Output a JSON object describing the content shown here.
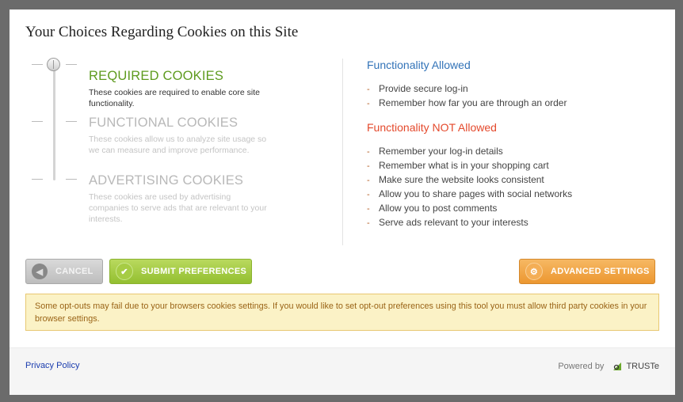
{
  "dialog": {
    "title": "Your Choices Regarding Cookies on this Site"
  },
  "levels": [
    {
      "name": "REQUIRED COOKIES",
      "description": "These cookies are required to enable core site functionality.",
      "state": "active"
    },
    {
      "name": "FUNCTIONAL COOKIES",
      "description": "These cookies allow us to analyze site usage so we can measure and improve performance.",
      "state": "inactive"
    },
    {
      "name": "ADVERTISING COOKIES",
      "description": "These cookies are used by advertising companies to serve ads that are relevant to your interests.",
      "state": "inactive"
    }
  ],
  "functionality": {
    "allowed_title": "Functionality Allowed",
    "allowed": [
      "Provide secure log-in",
      "Remember how far you are through an order"
    ],
    "not_allowed_title": "Functionality NOT Allowed",
    "not_allowed": [
      "Remember your log-in details",
      "Remember what is in your shopping cart",
      "Make sure the website looks consistent",
      "Allow you to share pages with social networks",
      "Allow you to post comments",
      "Serve ads relevant to your interests"
    ]
  },
  "buttons": {
    "cancel": "CANCEL",
    "submit": "SUBMIT PREFERENCES",
    "advanced": "ADVANCED SETTINGS"
  },
  "notice": "Some opt-outs may fail due to your browsers cookies settings. If you would like to set opt-out preferences using this tool you must allow third party cookies in your browser settings.",
  "footer": {
    "privacy_link": "Privacy Policy",
    "powered_by": "Powered by",
    "brand": "TRUSTe"
  },
  "colors": {
    "active_level": "#5e9b1f",
    "allowed_title": "#3273b8",
    "not_allowed_title": "#e4492c",
    "submit_button": "#a3c844",
    "advanced_button": "#f0a444",
    "notice_bg": "#fbf2c6"
  },
  "icons": {
    "cancel": "chevron-left-icon",
    "submit": "checkmark-icon",
    "advanced": "gear-icon"
  }
}
